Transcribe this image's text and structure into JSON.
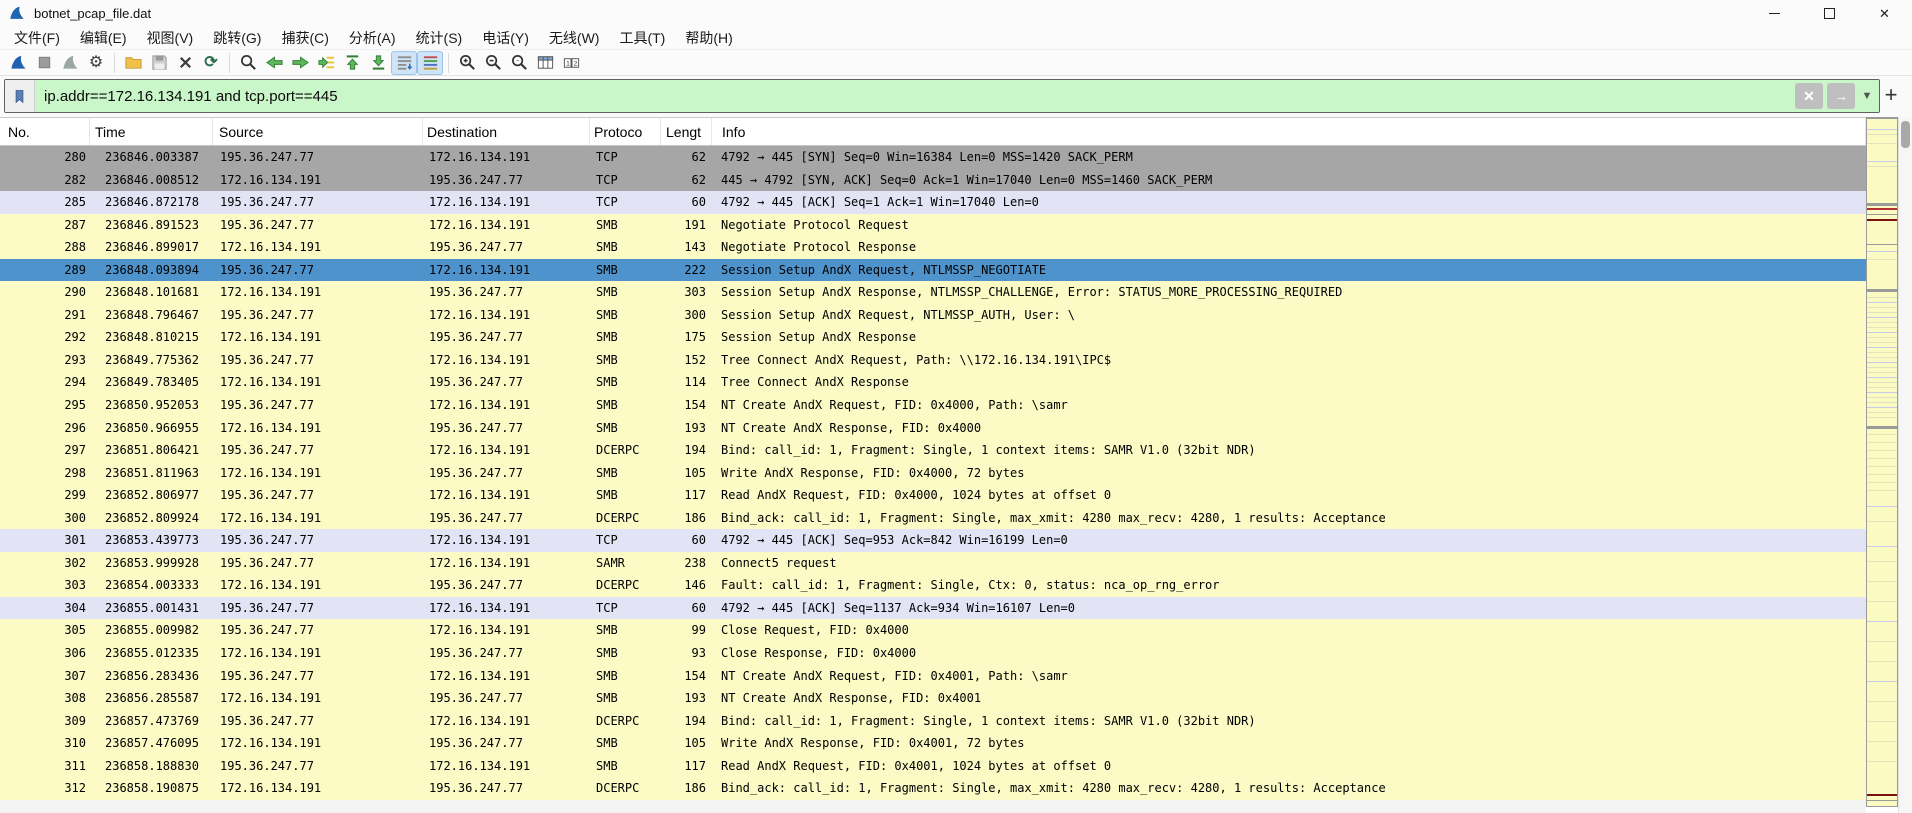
{
  "window": {
    "title": "botnet_pcap_file.dat",
    "app_icon": "wireshark-fin-icon",
    "controls": [
      "minimize",
      "maximize",
      "close"
    ]
  },
  "menu": {
    "items": [
      "文件(F)",
      "编辑(E)",
      "视图(V)",
      "跳转(G)",
      "捕获(C)",
      "分析(A)",
      "统计(S)",
      "电话(Y)",
      "无线(W)",
      "工具(T)",
      "帮助(H)"
    ]
  },
  "toolbar": {
    "groups": [
      [
        "start-capture",
        "stop-capture",
        "restart-capture",
        "capture-options"
      ],
      [
        "open-file",
        "save-file",
        "close-file",
        "reload-file"
      ],
      [
        "find-packet",
        "go-back",
        "go-forward",
        "go-to-packet",
        "go-first-packet",
        "go-last-packet",
        "auto-scroll",
        "colorize"
      ],
      [
        "zoom-in",
        "zoom-out",
        "zoom-normal",
        "resize-columns",
        "resize-columns-content"
      ]
    ],
    "active": [
      "auto-scroll",
      "colorize"
    ]
  },
  "filter": {
    "value": "ip.addr==172.16.134.191 and tcp.port==445",
    "bookmark_icon": "bookmark-icon",
    "clear_icon": "clear-filter-icon",
    "apply_icon": "apply-filter-icon",
    "dropdown_icon": "chevron-down-icon",
    "add_label": "+"
  },
  "packet_list": {
    "columns": [
      "No.",
      "Time",
      "Source",
      "Destination",
      "Protoco",
      "Lengt",
      "Info"
    ],
    "selected_no": "289",
    "rows": [
      {
        "no": "280",
        "time": "236846.003387",
        "source": "195.36.247.77",
        "destination": "172.16.134.191",
        "protocol": "TCP",
        "length": "62",
        "info": "4792 → 445 [SYN] Seq=0 Win=16384 Len=0 MSS=1420 SACK_PERM",
        "color": "gray"
      },
      {
        "no": "282",
        "time": "236846.008512",
        "source": "172.16.134.191",
        "destination": "195.36.247.77",
        "protocol": "TCP",
        "length": "62",
        "info": "445 → 4792 [SYN, ACK] Seq=0 Ack=1 Win=17040 Len=0 MSS=1460 SACK_PERM",
        "color": "gray"
      },
      {
        "no": "285",
        "time": "236846.872178",
        "source": "195.36.247.77",
        "destination": "172.16.134.191",
        "protocol": "TCP",
        "length": "60",
        "info": "4792 → 445 [ACK] Seq=1 Ack=1 Win=17040 Len=0",
        "color": "lavender"
      },
      {
        "no": "287",
        "time": "236846.891523",
        "source": "195.36.247.77",
        "destination": "172.16.134.191",
        "protocol": "SMB",
        "length": "191",
        "info": "Negotiate Protocol Request",
        "color": "yellow"
      },
      {
        "no": "288",
        "time": "236846.899017",
        "source": "172.16.134.191",
        "destination": "195.36.247.77",
        "protocol": "SMB",
        "length": "143",
        "info": "Negotiate Protocol Response",
        "color": "yellow"
      },
      {
        "no": "289",
        "time": "236848.093894",
        "source": "195.36.247.77",
        "destination": "172.16.134.191",
        "protocol": "SMB",
        "length": "222",
        "info": "Session Setup AndX Request, NTLMSSP_NEGOTIATE",
        "color": "yellow"
      },
      {
        "no": "290",
        "time": "236848.101681",
        "source": "172.16.134.191",
        "destination": "195.36.247.77",
        "protocol": "SMB",
        "length": "303",
        "info": "Session Setup AndX Response, NTLMSSP_CHALLENGE, Error: STATUS_MORE_PROCESSING_REQUIRED",
        "color": "yellow"
      },
      {
        "no": "291",
        "time": "236848.796467",
        "source": "195.36.247.77",
        "destination": "172.16.134.191",
        "protocol": "SMB",
        "length": "300",
        "info": "Session Setup AndX Request, NTLMSSP_AUTH, User: \\",
        "color": "yellow"
      },
      {
        "no": "292",
        "time": "236848.810215",
        "source": "172.16.134.191",
        "destination": "195.36.247.77",
        "protocol": "SMB",
        "length": "175",
        "info": "Session Setup AndX Response",
        "color": "yellow"
      },
      {
        "no": "293",
        "time": "236849.775362",
        "source": "195.36.247.77",
        "destination": "172.16.134.191",
        "protocol": "SMB",
        "length": "152",
        "info": "Tree Connect AndX Request, Path: \\\\172.16.134.191\\IPC$",
        "color": "yellow"
      },
      {
        "no": "294",
        "time": "236849.783405",
        "source": "172.16.134.191",
        "destination": "195.36.247.77",
        "protocol": "SMB",
        "length": "114",
        "info": "Tree Connect AndX Response",
        "color": "yellow"
      },
      {
        "no": "295",
        "time": "236850.952053",
        "source": "195.36.247.77",
        "destination": "172.16.134.191",
        "protocol": "SMB",
        "length": "154",
        "info": "NT Create AndX Request, FID: 0x4000, Path: \\samr",
        "color": "yellow"
      },
      {
        "no": "296",
        "time": "236850.966955",
        "source": "172.16.134.191",
        "destination": "195.36.247.77",
        "protocol": "SMB",
        "length": "193",
        "info": "NT Create AndX Response, FID: 0x4000",
        "color": "yellow"
      },
      {
        "no": "297",
        "time": "236851.806421",
        "source": "195.36.247.77",
        "destination": "172.16.134.191",
        "protocol": "DCERPC",
        "length": "194",
        "info": "Bind: call_id: 1, Fragment: Single, 1 context items: SAMR V1.0 (32bit NDR)",
        "color": "yellow"
      },
      {
        "no": "298",
        "time": "236851.811963",
        "source": "172.16.134.191",
        "destination": "195.36.247.77",
        "protocol": "SMB",
        "length": "105",
        "info": "Write AndX Response, FID: 0x4000, 72 bytes",
        "color": "yellow"
      },
      {
        "no": "299",
        "time": "236852.806977",
        "source": "195.36.247.77",
        "destination": "172.16.134.191",
        "protocol": "SMB",
        "length": "117",
        "info": "Read AndX Request, FID: 0x4000, 1024 bytes at offset 0",
        "color": "yellow"
      },
      {
        "no": "300",
        "time": "236852.809924",
        "source": "172.16.134.191",
        "destination": "195.36.247.77",
        "protocol": "DCERPC",
        "length": "186",
        "info": "Bind_ack: call_id: 1, Fragment: Single, max_xmit: 4280 max_recv: 4280, 1 results: Acceptance",
        "color": "yellow"
      },
      {
        "no": "301",
        "time": "236853.439773",
        "source": "195.36.247.77",
        "destination": "172.16.134.191",
        "protocol": "TCP",
        "length": "60",
        "info": "4792 → 445 [ACK] Seq=953 Ack=842 Win=16199 Len=0",
        "color": "lavender"
      },
      {
        "no": "302",
        "time": "236853.999928",
        "source": "195.36.247.77",
        "destination": "172.16.134.191",
        "protocol": "SAMR",
        "length": "238",
        "info": "Connect5 request",
        "color": "yellow"
      },
      {
        "no": "303",
        "time": "236854.003333",
        "source": "172.16.134.191",
        "destination": "195.36.247.77",
        "protocol": "DCERPC",
        "length": "146",
        "info": "Fault: call_id: 1, Fragment: Single, Ctx: 0, status: nca_op_rng_error",
        "color": "yellow"
      },
      {
        "no": "304",
        "time": "236855.001431",
        "source": "195.36.247.77",
        "destination": "172.16.134.191",
        "protocol": "TCP",
        "length": "60",
        "info": "4792 → 445 [ACK] Seq=1137 Ack=934 Win=16107 Len=0",
        "color": "lavender"
      },
      {
        "no": "305",
        "time": "236855.009982",
        "source": "195.36.247.77",
        "destination": "172.16.134.191",
        "protocol": "SMB",
        "length": "99",
        "info": "Close Request, FID: 0x4000",
        "color": "yellow"
      },
      {
        "no": "306",
        "time": "236855.012335",
        "source": "172.16.134.191",
        "destination": "195.36.247.77",
        "protocol": "SMB",
        "length": "93",
        "info": "Close Response, FID: 0x4000",
        "color": "yellow"
      },
      {
        "no": "307",
        "time": "236856.283436",
        "source": "195.36.247.77",
        "destination": "172.16.134.191",
        "protocol": "SMB",
        "length": "154",
        "info": "NT Create AndX Request, FID: 0x4001, Path: \\samr",
        "color": "yellow"
      },
      {
        "no": "308",
        "time": "236856.285587",
        "source": "172.16.134.191",
        "destination": "195.36.247.77",
        "protocol": "SMB",
        "length": "193",
        "info": "NT Create AndX Response, FID: 0x4001",
        "color": "yellow"
      },
      {
        "no": "309",
        "time": "236857.473769",
        "source": "195.36.247.77",
        "destination": "172.16.134.191",
        "protocol": "DCERPC",
        "length": "194",
        "info": "Bind: call_id: 1, Fragment: Single, 1 context items: SAMR V1.0 (32bit NDR)",
        "color": "yellow"
      },
      {
        "no": "310",
        "time": "236857.476095",
        "source": "172.16.134.191",
        "destination": "195.36.247.77",
        "protocol": "SMB",
        "length": "105",
        "info": "Write AndX Response, FID: 0x4001, 72 bytes",
        "color": "yellow"
      },
      {
        "no": "311",
        "time": "236858.188830",
        "source": "195.36.247.77",
        "destination": "172.16.134.191",
        "protocol": "SMB",
        "length": "117",
        "info": "Read AndX Request, FID: 0x4001, 1024 bytes at offset 0",
        "color": "yellow"
      },
      {
        "no": "312",
        "time": "236858.190875",
        "source": "172.16.134.191",
        "destination": "195.36.247.77",
        "protocol": "DCERPC",
        "length": "186",
        "info": "Bind_ack: call_id: 1, Fragment: Single, max_xmit: 4280 max_recv: 4280, 1 results: Acceptance",
        "color": "yellow"
      }
    ]
  },
  "colors": {
    "row_yellow": "#fcfbc6",
    "row_gray": "#a6a6a6",
    "row_lavender": "#e3e3f6",
    "row_selected": "#4f93cc",
    "filter_valid_bg": "#c9f7c9",
    "toggle_active_bg": "#cfe4f7",
    "minimap_bg": "#fbfac2"
  },
  "minimap": {
    "marks": [
      [
        10,
        "l"
      ],
      [
        15,
        "f"
      ],
      [
        24,
        "f"
      ],
      [
        42,
        "l"
      ],
      [
        47,
        "f"
      ],
      [
        84,
        "g3"
      ],
      [
        89,
        "r"
      ],
      [
        95,
        "g"
      ],
      [
        100,
        "d"
      ],
      [
        125,
        "g"
      ],
      [
        132,
        "l"
      ],
      [
        140,
        "f"
      ],
      [
        170,
        "g3"
      ],
      [
        178,
        "f"
      ],
      [
        183,
        "l"
      ],
      [
        188,
        "f"
      ],
      [
        193,
        "f"
      ],
      [
        198,
        "l"
      ],
      [
        203,
        "f"
      ],
      [
        208,
        "f"
      ],
      [
        213,
        "l"
      ],
      [
        218,
        "f"
      ],
      [
        223,
        "f"
      ],
      [
        228,
        "l"
      ],
      [
        233,
        "f"
      ],
      [
        238,
        "f"
      ],
      [
        243,
        "l"
      ],
      [
        248,
        "f"
      ],
      [
        253,
        "f"
      ],
      [
        258,
        "l"
      ],
      [
        263,
        "f"
      ],
      [
        268,
        "f"
      ],
      [
        273,
        "l"
      ],
      [
        278,
        "f"
      ],
      [
        283,
        "f"
      ],
      [
        288,
        "l"
      ],
      [
        293,
        "f"
      ],
      [
        298,
        "f"
      ],
      [
        307,
        "g3"
      ],
      [
        315,
        "f"
      ],
      [
        323,
        "f"
      ],
      [
        331,
        "f"
      ],
      [
        339,
        "f"
      ],
      [
        347,
        "f"
      ],
      [
        355,
        "f"
      ],
      [
        363,
        "f"
      ],
      [
        371,
        "f"
      ],
      [
        387,
        "l"
      ],
      [
        402,
        "f"
      ],
      [
        427,
        "l"
      ],
      [
        442,
        "f"
      ],
      [
        462,
        "f"
      ],
      [
        482,
        "f"
      ],
      [
        502,
        "l"
      ],
      [
        522,
        "f"
      ],
      [
        542,
        "f"
      ],
      [
        562,
        "l"
      ],
      [
        582,
        "f"
      ],
      [
        602,
        "f"
      ],
      [
        622,
        "f"
      ],
      [
        642,
        "f"
      ],
      [
        675,
        "d"
      ],
      [
        681,
        "g"
      ]
    ]
  }
}
